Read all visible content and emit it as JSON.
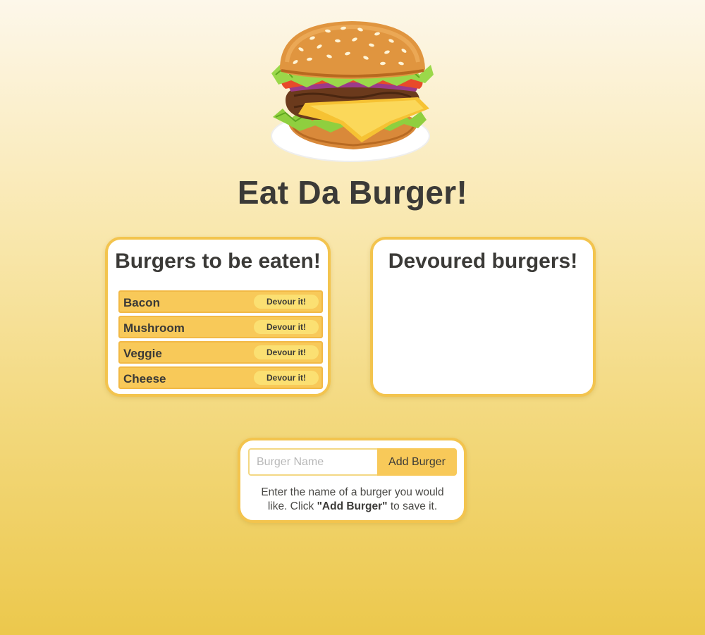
{
  "header": {
    "logo_icon": "burger-icon",
    "title": "Eat Da Burger!"
  },
  "to_eat": {
    "title": "Burgers to be eaten!",
    "items": [
      {
        "name": "Bacon",
        "button": "Devour it!"
      },
      {
        "name": "Mushroom",
        "button": "Devour it!"
      },
      {
        "name": "Veggie",
        "button": "Devour it!"
      },
      {
        "name": "Cheese",
        "button": "Devour it!"
      }
    ]
  },
  "devoured": {
    "title": "Devoured burgers!",
    "items": []
  },
  "form": {
    "placeholder": "Burger Name",
    "value": "",
    "button": "Add Burger",
    "help_before": "Enter the name of a burger you would like. Click ",
    "help_bold": "\"Add Burger\"",
    "help_after": " to save it."
  },
  "colors": {
    "accent": "#f8c959",
    "border": "#f3c44e",
    "button": "#fbe072",
    "text": "#3b3a37"
  }
}
